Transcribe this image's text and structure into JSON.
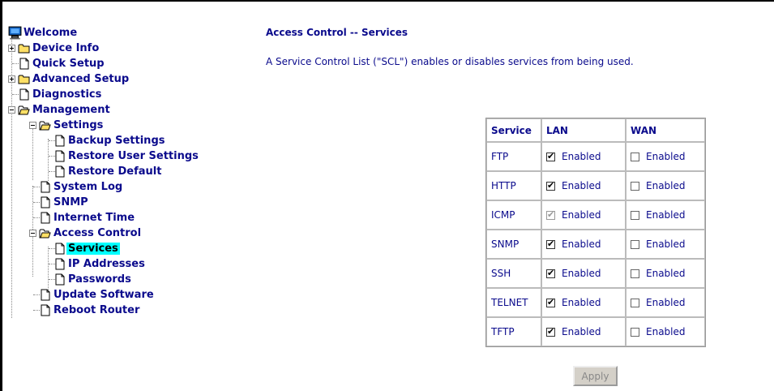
{
  "nav": {
    "welcome": "Welcome",
    "device_info": "Device Info",
    "quick_setup": "Quick Setup",
    "advanced_setup": "Advanced Setup",
    "diagnostics": "Diagnostics",
    "management": "Management",
    "settings": "Settings",
    "backup_settings": "Backup Settings",
    "restore_user_settings": "Restore User Settings",
    "restore_default": "Restore Default",
    "system_log": "System Log",
    "snmp": "SNMP",
    "internet_time": "Internet Time",
    "access_control": "Access Control",
    "services": "Services",
    "ip_addresses": "IP Addresses",
    "passwords": "Passwords",
    "update_software": "Update Software",
    "reboot_router": "Reboot Router"
  },
  "page": {
    "title": "Access Control -- Services",
    "description": "A Service Control List (\"SCL\") enables or disables services from being used."
  },
  "table": {
    "headers": {
      "service": "Service",
      "lan": "LAN",
      "wan": "WAN"
    },
    "enabled_label": "Enabled",
    "rows": [
      {
        "service": "FTP",
        "lan": "checked",
        "wan": "unchecked"
      },
      {
        "service": "HTTP",
        "lan": "checked",
        "wan": "unchecked"
      },
      {
        "service": "ICMP",
        "lan": "checked-disabled",
        "wan": "unchecked"
      },
      {
        "service": "SNMP",
        "lan": "checked",
        "wan": "unchecked"
      },
      {
        "service": "SSH",
        "lan": "checked",
        "wan": "unchecked"
      },
      {
        "service": "TELNET",
        "lan": "checked",
        "wan": "unchecked"
      },
      {
        "service": "TFTP",
        "lan": "checked",
        "wan": "unchecked"
      }
    ]
  },
  "apply_label": "Apply",
  "colors": {
    "text": "#0a0a8c",
    "highlight": "#00ffff",
    "folder": "#ffe066"
  },
  "icons": {
    "welcome": "computer-icon",
    "folder": "folder-icon",
    "page": "page-icon",
    "expand": "expand-box-icon",
    "collapse": "collapse-box-icon"
  }
}
